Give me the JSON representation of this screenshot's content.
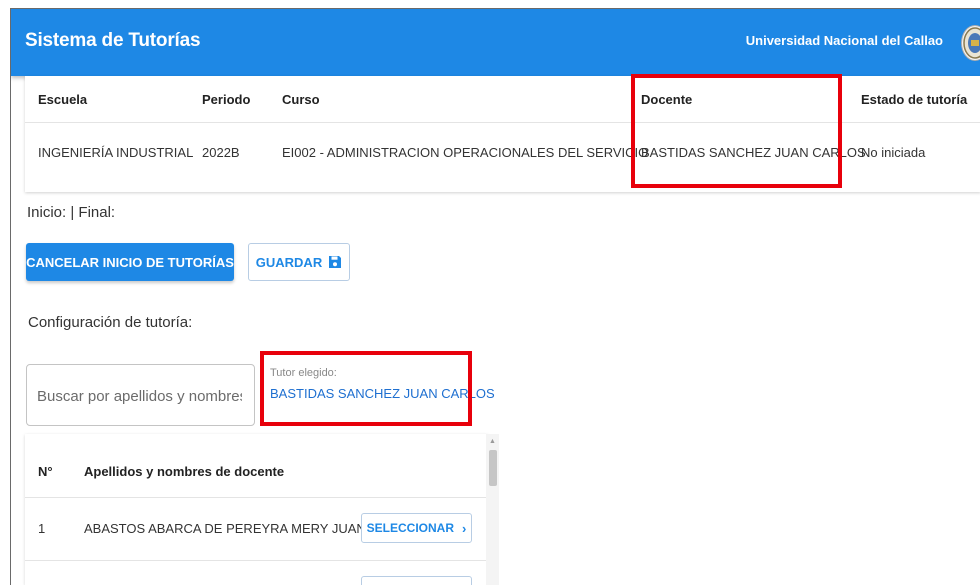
{
  "header": {
    "title": "Sistema de Tutorías",
    "university": "Universidad Nacional del Callao",
    "logo": "university-seal-icon",
    "bar_color": "#1e88e5"
  },
  "course_table": {
    "columns": [
      "Escuela",
      "Periodo",
      "Curso",
      "Docente",
      "Estado de tutoría"
    ],
    "row": {
      "escuela": "INGENIERÍA INDUSTRIAL",
      "periodo": "2022B",
      "curso": "EI002 - ADMINISTRACION OPERACIONALES DEL SERVICIO",
      "docente": "BASTIDAS SANCHEZ JUAN CARLOS",
      "estado": "No iniciada"
    }
  },
  "dates_label": "Inicio:   | Final:",
  "actions": {
    "cancel_label": "CANCELAR INICIO DE TUTORÍAS",
    "save_label": "GUARDAR",
    "save_icon": "floppy-disk-icon"
  },
  "config": {
    "label": "Configuración de tutoría:",
    "search_placeholder": "Buscar por apellidos y nombres",
    "search_value": "",
    "chosen_caption": "Tutor elegido:",
    "chosen_name": "BASTIDAS SANCHEZ JUAN CARLOS"
  },
  "teachers": {
    "columns": [
      "N°",
      "Apellidos y nombres de docente"
    ],
    "rows": [
      {
        "n": "1",
        "name": "ABASTOS ABARCA DE PEREYRA MERY JUANA",
        "action": "SELECCIONAR"
      }
    ],
    "next_row_action": ""
  },
  "highlight_color": "#e8000b"
}
